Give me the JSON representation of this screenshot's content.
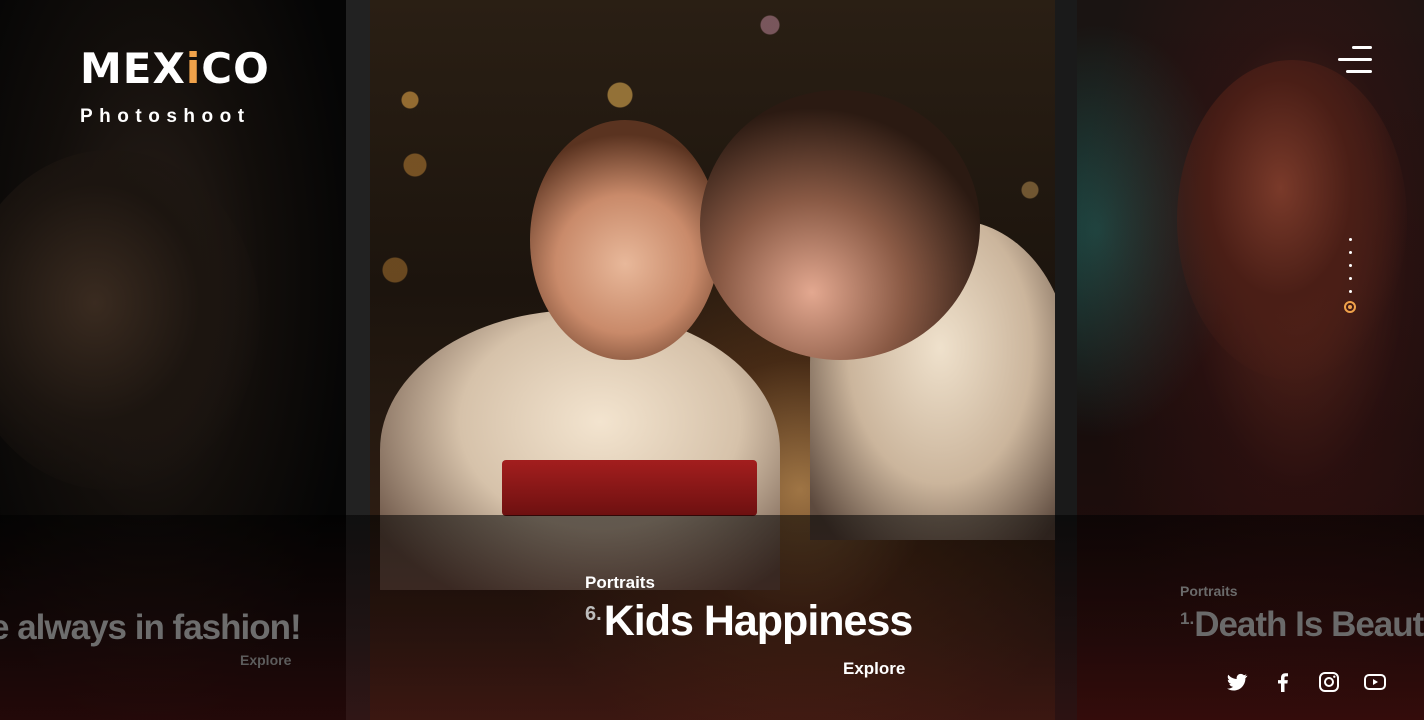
{
  "brand": {
    "title_pre": "MEX",
    "title_accent": "i",
    "title_post": "CO",
    "subtitle": "Photoshoot",
    "accent_color": "#f0a24a"
  },
  "menu": {
    "icon": "hamburger-menu-icon"
  },
  "pager": {
    "count": 6,
    "active_index": 6
  },
  "slides": {
    "previous": {
      "title": "e always in fashion!",
      "explore": "Explore"
    },
    "current": {
      "category": "Portraits",
      "number": "6.",
      "title": "Kids Happiness",
      "explore": "Explore"
    },
    "next": {
      "category": "Portraits",
      "number": "1.",
      "title": "Death Is Beaut"
    }
  },
  "social": [
    "twitter-icon",
    "facebook-icon",
    "instagram-icon",
    "youtube-icon"
  ]
}
